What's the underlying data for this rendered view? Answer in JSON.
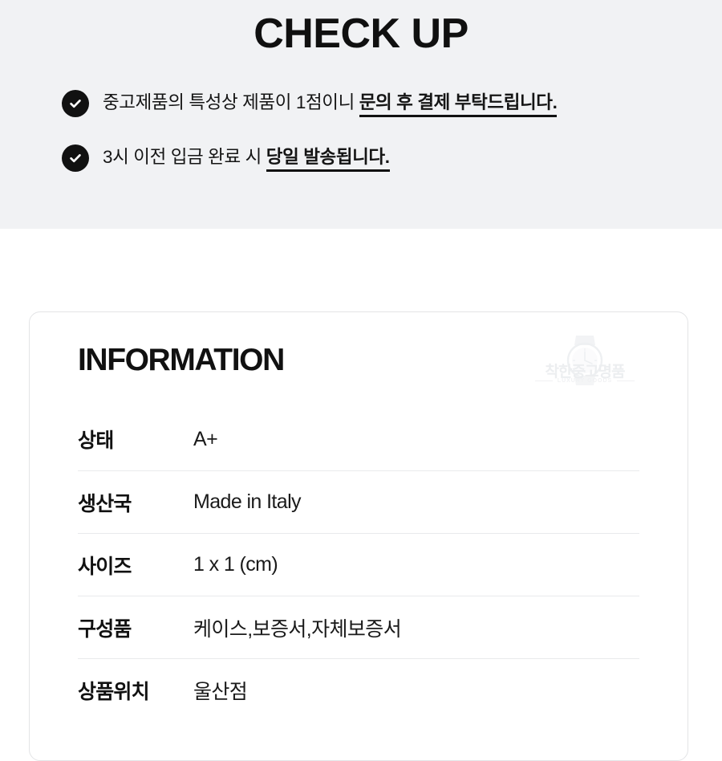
{
  "checkup": {
    "title": "CHECK UP",
    "items": [
      {
        "icon": "check-circle-icon",
        "plain": "중고제품의 특성상 제품이 1점이니 ",
        "strong": "문의 후 결제 부탁드립니다."
      },
      {
        "icon": "check-circle-icon",
        "plain": "3시 이전 입금 완료 시 ",
        "strong": "당일 발송됩니다.",
        "strong_tail": "."
      }
    ]
  },
  "information": {
    "title": "INFORMATION",
    "watermark": {
      "icon": "watch-logo-icon",
      "brand": "착한중고명품",
      "subtitle": "LUXURY GOODS"
    },
    "rows": [
      {
        "label": "상태",
        "value": "A+"
      },
      {
        "label": "생산국",
        "value": "Made in Italy"
      },
      {
        "label": "사이즈",
        "value": "1 x 1 (cm)"
      },
      {
        "label": "구성품",
        "value": "케이스,보증서,자체보증서"
      },
      {
        "label": "상품위치",
        "value": "울산점"
      }
    ]
  },
  "colors": {
    "band_background": "#f1f2f4",
    "page_background": "#ffffff",
    "ink": "#111111",
    "divider": "#e9eaec",
    "card_border": "#e3e4e6",
    "watermark": "#eceef0"
  }
}
